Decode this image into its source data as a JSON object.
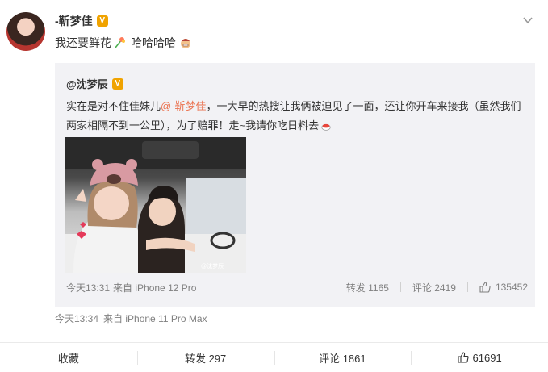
{
  "post": {
    "author": "-靳梦佳",
    "verified_badge": "V",
    "text": "我还要鲜花",
    "text_suffix": "哈哈哈哈",
    "meta": {
      "time": "今天13:34",
      "source": "来自 iPhone 11 Pro Max"
    },
    "actions": {
      "favorite": "收藏",
      "repost": "转发 297",
      "comment": "评论 1861",
      "like": "61691"
    }
  },
  "repost": {
    "author": "@沈梦辰",
    "verified_badge": "V",
    "text_before": "实在是对不住佳妹儿",
    "mention": "@-靳梦佳",
    "text_after": "，一大早的热搜让我俩被迫见了一面，还让你开车来接我（虽然我们两家相隔不到一公里），为了赔罪！走~我请你吃日料去",
    "photo_watermark": "@沈梦辰",
    "meta": {
      "time": "今天13:31",
      "source": "来自 iPhone 12 Pro"
    },
    "actions": {
      "repost": "转发 1165",
      "comment": "评论 2419",
      "like": "135452"
    }
  },
  "colors": {
    "mention": "#eb7350",
    "badge": "#f0a300",
    "repost_bg": "#f2f2f5"
  }
}
